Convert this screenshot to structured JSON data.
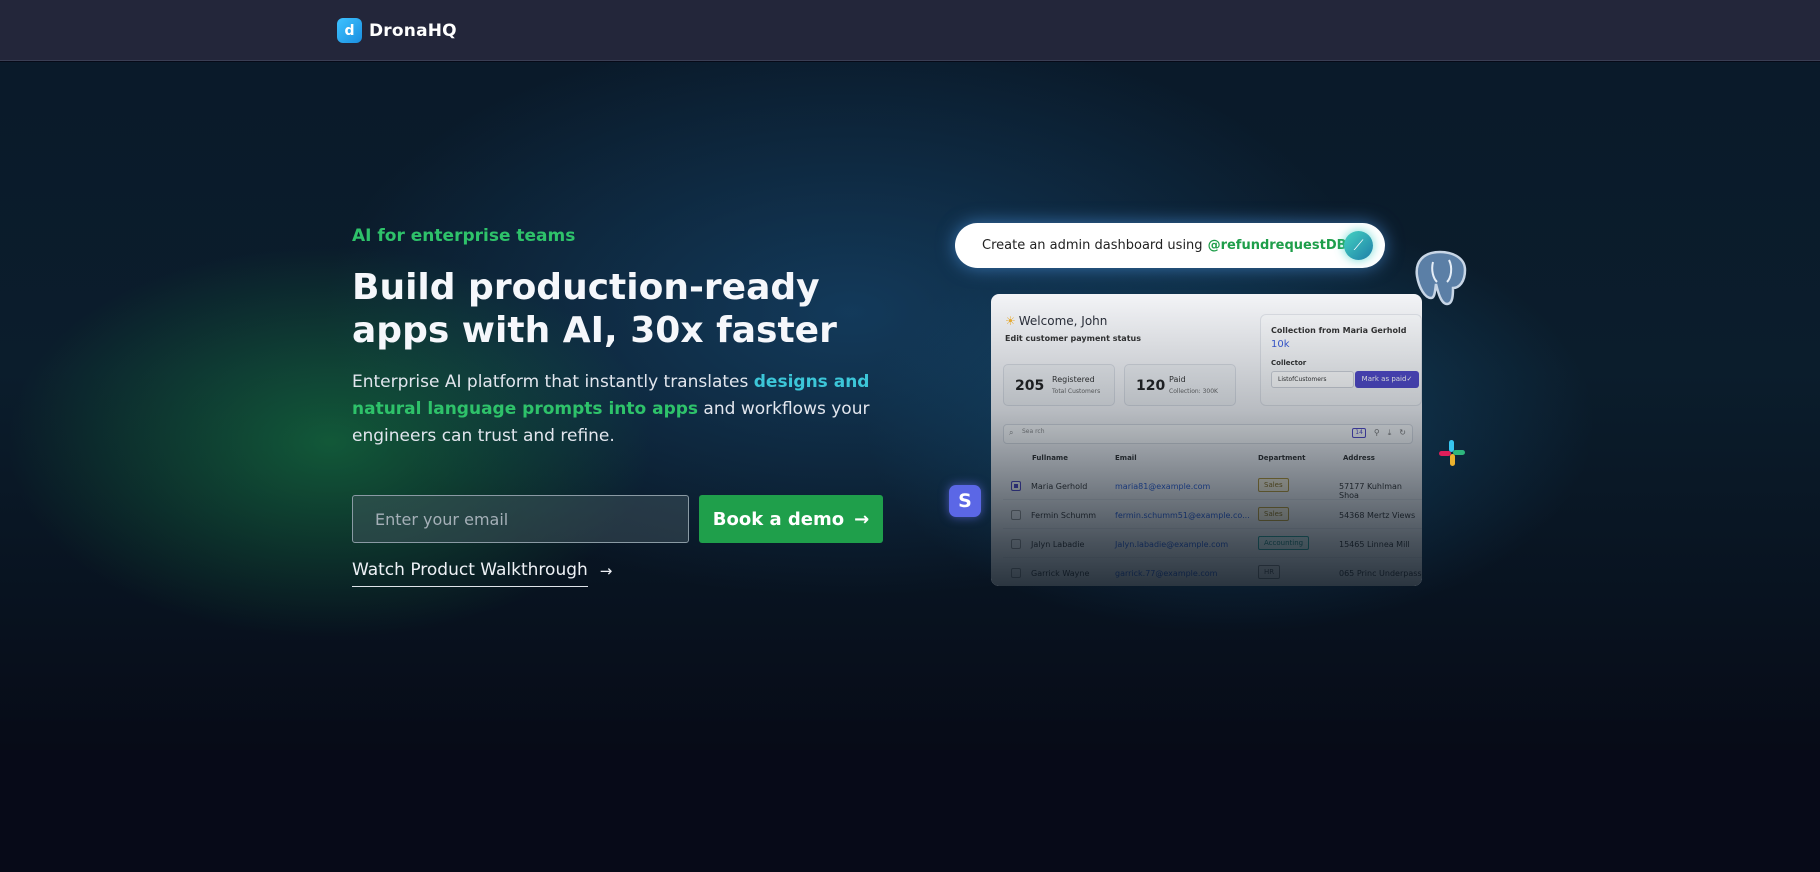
{
  "brand": {
    "name": "DronaHQ",
    "mark": "d"
  },
  "hero": {
    "eyebrow": "AI for enterprise teams",
    "headline": "Build production-ready apps with AI, 30x faster",
    "subtext_pre": "Enterprise AI platform that instantly translates ",
    "subtext_hl1": "designs and",
    "subtext_hl2": "natural language prompts into apps",
    "subtext_post": " and workflows your engineers can trust and refine.",
    "email_placeholder": "Enter your email",
    "demo_button": "Book a demo",
    "demo_arrow": "→",
    "walkthrough_link": "Watch Product Walkthrough",
    "walkthrough_arrow": "→"
  },
  "prompt": {
    "text": "Create an admin dashboard using",
    "mention": "@refundrequestDB"
  },
  "dashboard": {
    "welcome": "Welcome, John",
    "subtitle": "Edit customer payment status",
    "stats": [
      {
        "value": "205",
        "label": "Registered",
        "sub": "Total Customers"
      },
      {
        "value": "120",
        "label": "Paid",
        "sub": "Collection: 300K"
      }
    ],
    "collection": {
      "title": "Collection from Maria Gerhold",
      "value": "10k",
      "collector_label": "Collector",
      "collector_value": "ListofCustomers",
      "action": "Mark as paid✓"
    },
    "search_placeholder": "Sea rch",
    "columns": [
      "Fullname",
      "Email",
      "Department",
      "Address"
    ],
    "rows": [
      {
        "name": "Maria Gerhold",
        "email": "maria81@example.com",
        "dept": "Sales",
        "address": "57177 Kuhlman Shoa"
      },
      {
        "name": "Fermin Schumm",
        "email": "fermin.schumm51@example.co...",
        "dept": "Sales",
        "address": "54368 Mertz Views"
      },
      {
        "name": "Jalyn Labadie",
        "email": "Jalyn.labadie@example.com",
        "dept": "Accounting",
        "address": "15465 Linnea Mill"
      },
      {
        "name": "Garrick Wayne",
        "email": "garrick.77@example.com",
        "dept": "HR",
        "address": "065 Princ Underpass"
      }
    ]
  },
  "icons": {
    "postgres": "postgresql-icon",
    "slack": "slack-icon",
    "s_app": "S"
  },
  "colors": {
    "accent_green": "#1f9f4b",
    "highlight_teal": "#3cc6d8",
    "eyebrow_green": "#2ec26a",
    "topbar": "#23263a"
  }
}
